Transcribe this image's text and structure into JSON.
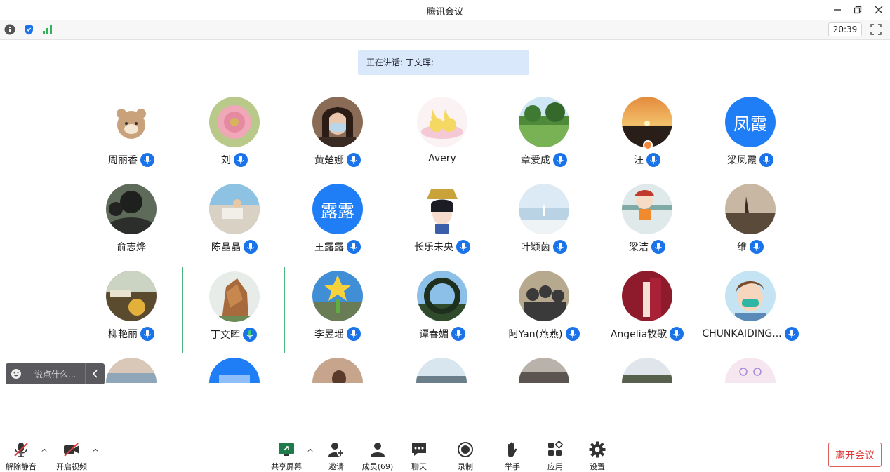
{
  "window": {
    "title": "腾讯会议",
    "time": "20:39"
  },
  "speaking": {
    "label": "正在讲话: 丁文晖;"
  },
  "participants": [
    {
      "name": "周丽香",
      "mic": true
    },
    {
      "name": "刘",
      "mic": true
    },
    {
      "name": "黄楚娜",
      "mic": true
    },
    {
      "name": "Avery",
      "mic": false
    },
    {
      "name": "章爱成",
      "mic": true
    },
    {
      "name": "汪",
      "mic": true,
      "host": true
    },
    {
      "name": "梁凤霞",
      "mic": true,
      "avatar_text": "凤霞"
    },
    {
      "name": "俞志烨",
      "mic": false
    },
    {
      "name": "陈晶晶",
      "mic": true
    },
    {
      "name": "王露露",
      "mic": true,
      "avatar_text": "露露"
    },
    {
      "name": "长乐未央",
      "mic": true
    },
    {
      "name": "叶颖茵",
      "mic": true
    },
    {
      "name": "梁洁",
      "mic": true
    },
    {
      "name": "维",
      "mic": true
    },
    {
      "name": "柳艳丽",
      "mic": true
    },
    {
      "name": "丁文晖",
      "mic": true,
      "speaking": true
    },
    {
      "name": "李昱瑶",
      "mic": true
    },
    {
      "name": "谭春媚",
      "mic": true
    },
    {
      "name": "阿Yan(燕燕)",
      "mic": true
    },
    {
      "name": "Angelia牧歌",
      "mic": true
    },
    {
      "name": "CHUNKAIDING...",
      "mic": true
    }
  ],
  "chat": {
    "placeholder": "说点什么..."
  },
  "toolbar": {
    "unmute": "解除静音",
    "video": "开启视频",
    "share": "共享屏幕",
    "invite": "邀请",
    "members": "成员(69)",
    "chat": "聊天",
    "record": "录制",
    "raise": "举手",
    "apps": "应用",
    "settings": "设置",
    "leave": "离开会议"
  },
  "colors": {
    "accent": "#1a73e8",
    "speaking_border": "#4bb67b",
    "leave": "#e03c3c"
  }
}
